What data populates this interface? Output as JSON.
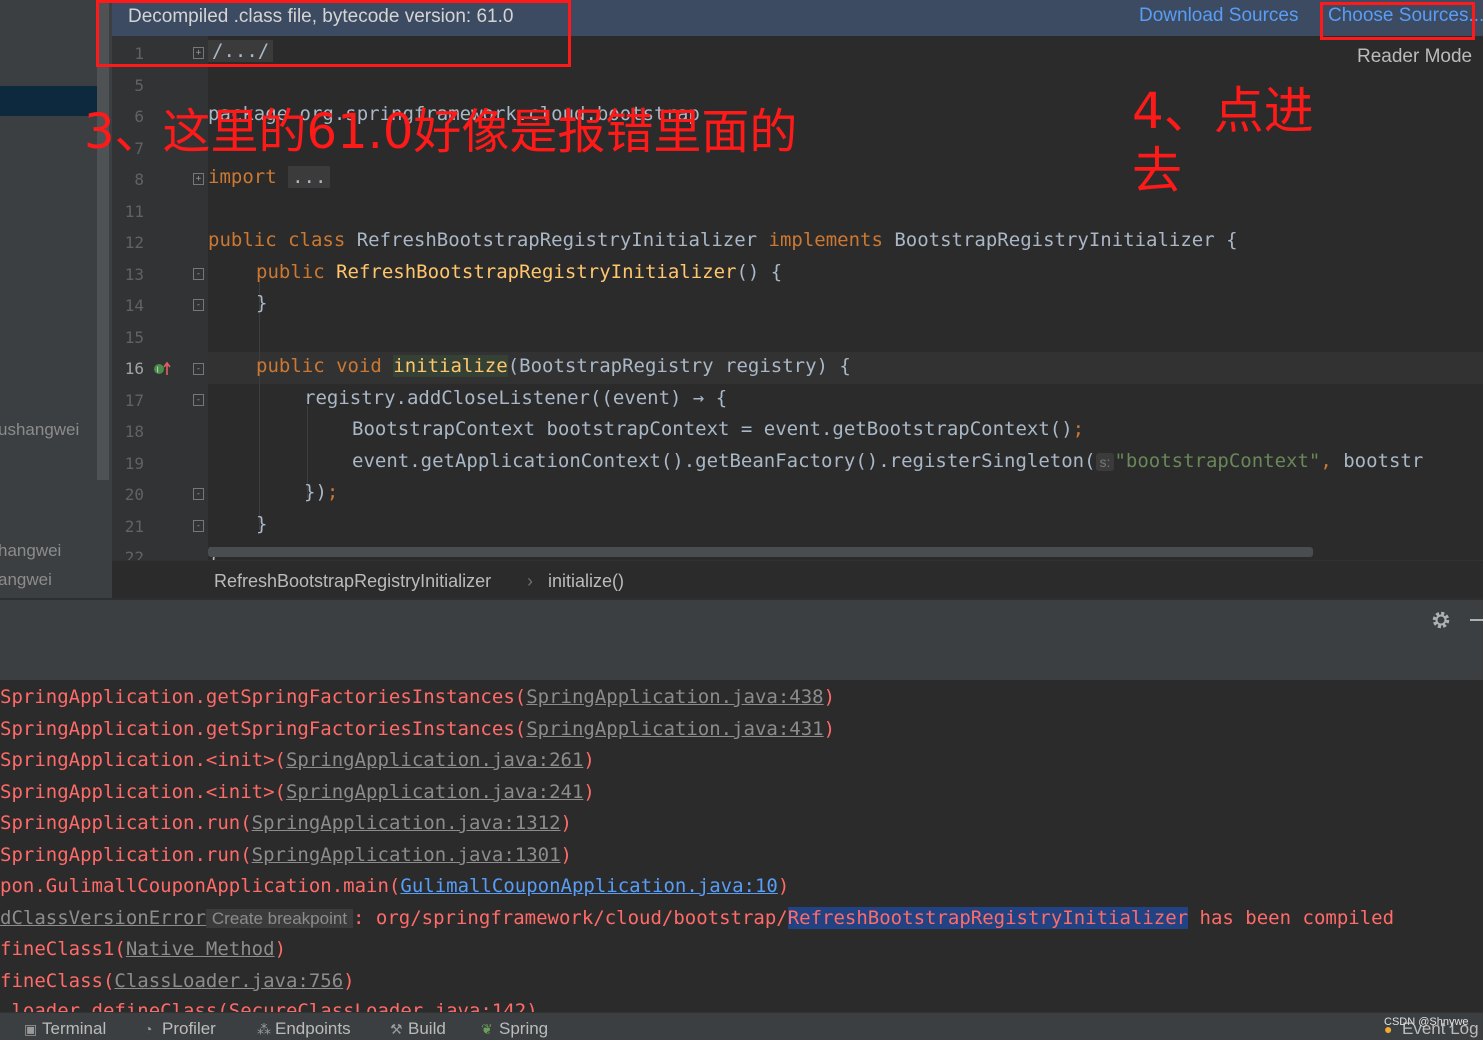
{
  "banner": {
    "title": "Decompiled .class file, bytecode version: 61.0",
    "download_sources": "Download Sources",
    "choose_sources": "Choose Sources...",
    "reader_mode": "Reader Mode"
  },
  "sidebar": {
    "labels": [
      "ushangwei",
      "hangwei",
      "angwei"
    ]
  },
  "editor": {
    "line_numbers": [
      "1",
      "5",
      "6",
      "7",
      "8",
      "11",
      "12",
      "13",
      "14",
      "15",
      "16",
      "17",
      "18",
      "19",
      "20",
      "21",
      "22"
    ],
    "code": {
      "l1": "/.../",
      "l6": "package org.springframework.cloud.bootstrap",
      "l8_kw": "import",
      "l8_fold": "...",
      "l12_kw1": "public class",
      "l12_name": " RefreshBootstrapRegistryInitializer ",
      "l12_kw2": "implements",
      "l12_rest": " BootstrapRegistryInitializer {",
      "l13_kw": "public",
      "l13_fn": "RefreshBootstrapRegistryInitializer",
      "l13_rest": "() {",
      "l14": "}",
      "l16_kw": "public void",
      "l16_fn": "initialize",
      "l16_rest": "(BootstrapRegistry registry) {",
      "l17": "registry.addCloseListener((event) → {",
      "l18": "BootstrapContext bootstrapContext = event.getBootstrapContext()",
      "l19_a": "event.getApplicationContext().getBeanFactory().registerSingleton(",
      "l19_hint": "s:",
      "l19_str": "\"bootstrapContext\"",
      "l19_b": " bootstr",
      "l20": "})",
      "l21": "}",
      "l22": "}"
    }
  },
  "breadcrumb": {
    "class": "RefreshBootstrapRegistryInitializer",
    "method": "initialize()"
  },
  "console": {
    "lines": [
      {
        "pre": "SpringApplication.getSpringFactoriesInstances(",
        "link": "SpringApplication.java:438",
        "post": ")"
      },
      {
        "pre": "SpringApplication.getSpringFactoriesInstances(",
        "link": "SpringApplication.java:431",
        "post": ")"
      },
      {
        "pre": "SpringApplication.<init>(",
        "link": "SpringApplication.java:261",
        "post": ")"
      },
      {
        "pre": "SpringApplication.<init>(",
        "link": "SpringApplication.java:241",
        "post": ")"
      },
      {
        "pre": "SpringApplication.run(",
        "link": "SpringApplication.java:1312",
        "post": ")"
      },
      {
        "pre": "SpringApplication.run(",
        "link": "SpringApplication.java:1301",
        "post": ")"
      },
      {
        "pre": "pon.GulimallCouponApplication.main(",
        "link": "GulimallCouponApplication.java:10",
        "post": ")"
      }
    ],
    "error_line": {
      "link": "dClassVersionError",
      "breakpoint": "Create breakpoint",
      "mid": ": org/springframework/cloud/bootstrap/",
      "selected": "RefreshBootstrapRegistryInitializer",
      "post": " has been compiled"
    },
    "line_native": {
      "pre": "fineClass1(",
      "link": "Native Method",
      "post": ")"
    },
    "line_loader": {
      "pre": "fineClass(",
      "link": "ClassLoader.java:756",
      "post": ")"
    },
    "line_partial": ".loader.defineClass(SecureClassLoader.java:142)"
  },
  "toolbar": {
    "terminal": "Terminal",
    "profiler": "Profiler",
    "endpoints": "Endpoints",
    "build": "Build",
    "spring": "Spring",
    "event_log": "Event Log",
    "watermark": "CSDN @Shnywe"
  },
  "annotations": {
    "note3": "3、这里的61.0好像是报错里面的",
    "note4_line1": "4、点进",
    "note4_line2": "去"
  },
  "colors": {
    "annotation_red": "#ff1a1a",
    "keyword": "#cc7832",
    "function": "#ffc66d",
    "string": "#6a8759",
    "error_text": "#ff6b68",
    "link_blue": "#589df6",
    "banner_bg": "#3c4b62"
  }
}
